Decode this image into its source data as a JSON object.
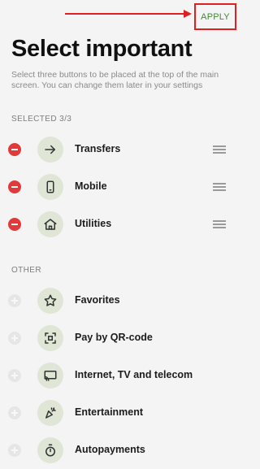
{
  "header": {
    "apply_label": "APPLY",
    "title": "Select important",
    "subtitle": "Select three buttons to be placed at the top of the main screen. You can change them later in your settings"
  },
  "selected": {
    "section_label": "SELECTED 3/3",
    "items": [
      {
        "label": "Transfers",
        "icon": "arrow-right-icon"
      },
      {
        "label": "Mobile",
        "icon": "phone-icon"
      },
      {
        "label": "Utilities",
        "icon": "house-icon"
      }
    ]
  },
  "other": {
    "section_label": "OTHER",
    "items": [
      {
        "label": "Favorites",
        "icon": "star-icon"
      },
      {
        "label": "Pay by QR-code",
        "icon": "qr-code-icon"
      },
      {
        "label": "Internet, TV and telecom",
        "icon": "tv-icon"
      },
      {
        "label": "Entertainment",
        "icon": "party-popper-icon"
      },
      {
        "label": "Autopayments",
        "icon": "stopwatch-icon"
      }
    ]
  },
  "colors": {
    "accent_green": "#3d8b2f",
    "annotation_red": "#e02020",
    "remove_red": "#e23a3a",
    "icon_bg": "#dfe6d6"
  }
}
